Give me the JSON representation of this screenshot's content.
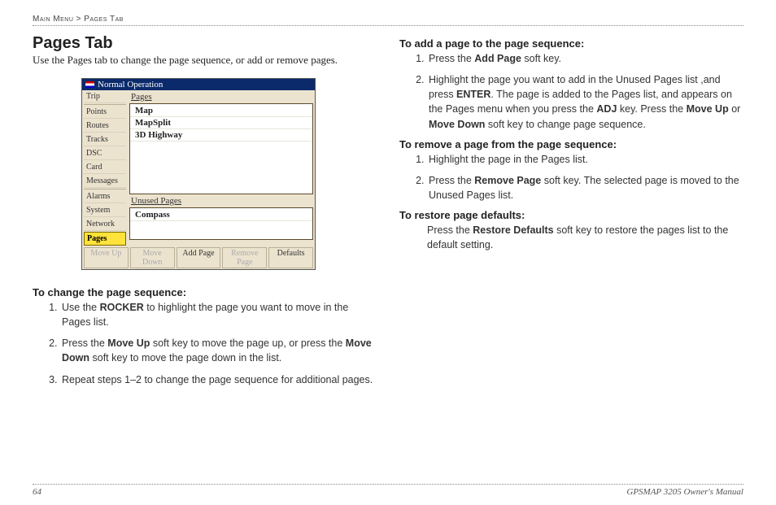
{
  "breadcrumb": {
    "a": "Main Menu",
    "sep": ">",
    "b": "Pages Tab"
  },
  "title": "Pages Tab",
  "intro": "Use the Pages tab to change the page sequence, or add or remove pages.",
  "screenshot": {
    "window_title": "Normal Operation",
    "sidebar": [
      "Trip",
      "",
      "Points",
      "Routes",
      "Tracks",
      "DSC",
      "Card",
      "Messages",
      "",
      "Alarms",
      "System",
      "Network",
      "Pages"
    ],
    "active_sidebar": "Pages",
    "pages_label": "Pages",
    "pages_items": [
      "Map",
      "MapSplit",
      "3D Highway"
    ],
    "unused_label": "Unused Pages",
    "unused_items": [
      "Compass"
    ],
    "buttons": [
      "Move Up",
      "Move Down",
      "Add Page",
      "Remove Page",
      "Defaults"
    ]
  },
  "left": {
    "h1": "To change the page sequence:",
    "steps": [
      [
        [
          "t",
          "Use the "
        ],
        [
          "b",
          "ROCKER"
        ],
        [
          "t",
          " to highlight the page you want to move in the Pages list."
        ]
      ],
      [
        [
          "t",
          "Press the "
        ],
        [
          "b",
          "Move Up"
        ],
        [
          "t",
          " soft key to move the page up, or press the "
        ],
        [
          "b",
          "Move Down"
        ],
        [
          "t",
          " soft key to move the page down in the list."
        ]
      ],
      [
        [
          "t",
          "Repeat steps 1–2 to change the page sequence for additional pages."
        ]
      ]
    ]
  },
  "right": {
    "sec1": {
      "h": "To add a page to the page sequence:",
      "steps": [
        [
          [
            "t",
            "Press the "
          ],
          [
            "b",
            "Add Page"
          ],
          [
            "t",
            " soft key."
          ]
        ],
        [
          [
            "t",
            "Highlight the page you want to add in the Unused Pages list ,and press "
          ],
          [
            "b",
            "ENTER"
          ],
          [
            "t",
            ". The page is added to the Pages list, and appears on the Pages menu when you press the "
          ],
          [
            "b",
            "ADJ"
          ],
          [
            "t",
            " key. Press the "
          ],
          [
            "b",
            "Move Up"
          ],
          [
            "t",
            " or "
          ],
          [
            "b",
            "Move Down"
          ],
          [
            "t",
            " soft key to change page sequence."
          ]
        ]
      ]
    },
    "sec2": {
      "h": "To remove a page from the page sequence:",
      "steps": [
        [
          [
            "t",
            "Highlight the page in the Pages list."
          ]
        ],
        [
          [
            "t",
            "Press the "
          ],
          [
            "b",
            "Remove Page"
          ],
          [
            "t",
            " soft key. The selected page is moved to the Unused Pages list."
          ]
        ]
      ]
    },
    "sec3": {
      "h": "To restore page defaults:",
      "para": [
        [
          "t",
          "Press the "
        ],
        [
          "b",
          "Restore Defaults"
        ],
        [
          "t",
          " soft key to restore the pages list to the default setting."
        ]
      ]
    }
  },
  "footer": {
    "page": "64",
    "doc": "GPSMAP 3205 Owner's Manual"
  }
}
